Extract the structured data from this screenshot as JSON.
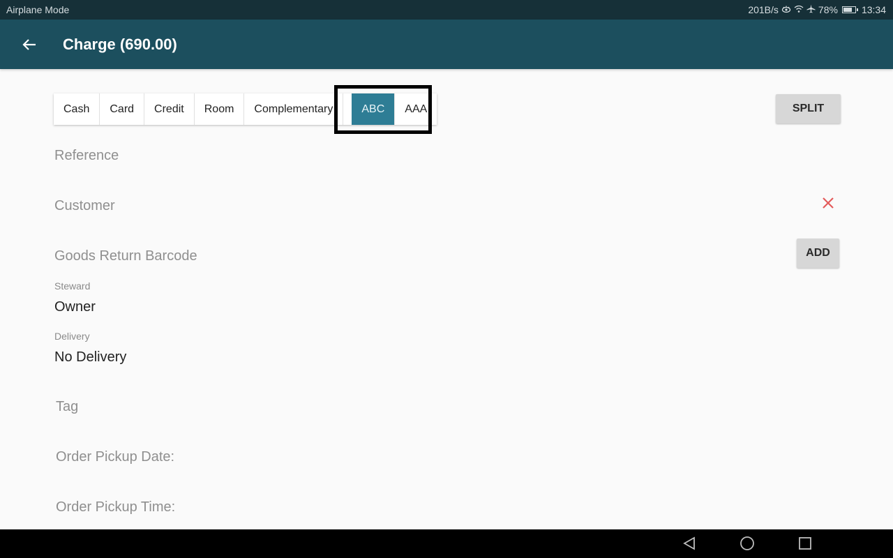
{
  "status_bar": {
    "left_text": "Airplane Mode",
    "net_speed": "201B/s",
    "icons": [
      "eye-comfort-icon",
      "wifi-icon",
      "airplane-icon"
    ],
    "battery": "78%",
    "battery_level": 0.78,
    "time": "13:34"
  },
  "app_bar": {
    "back_icon": "arrow-left-icon",
    "title": "Charge (690.00)"
  },
  "payment_tabs": {
    "items": [
      {
        "label": "Cash",
        "active": false
      },
      {
        "label": "Card",
        "active": false
      },
      {
        "label": "Credit",
        "active": false
      },
      {
        "label": "Room",
        "active": false
      },
      {
        "label": "Complementary",
        "active": false
      },
      {
        "label": "ABC",
        "active": true
      },
      {
        "label": "AAA",
        "active": false
      }
    ],
    "active_color": "#2e7d95"
  },
  "buttons": {
    "split": "SPLIT",
    "add": "ADD",
    "clear_customer_icon": "close-icon"
  },
  "form": {
    "reference_placeholder": "Reference",
    "customer_placeholder": "Customer",
    "goods_return_placeholder": "Goods Return Barcode",
    "steward_label": "Steward",
    "steward_value": "Owner",
    "delivery_label": "Delivery",
    "delivery_value": "No Delivery",
    "tag_placeholder": "Tag",
    "pickup_date_placeholder": "Order Pickup Date:",
    "pickup_time_placeholder": "Order Pickup Time:"
  },
  "nav_bar": {
    "back_icon": "nav-back-icon",
    "home_icon": "nav-home-icon",
    "recents_icon": "nav-recents-icon"
  }
}
